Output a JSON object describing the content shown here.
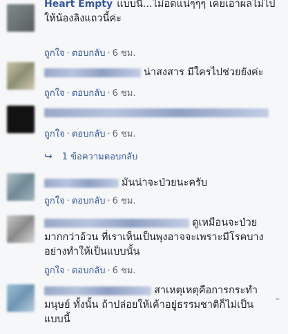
{
  "meta": {
    "like": "ถูกใจ",
    "sep": "·",
    "reply": "ตอบกลับ",
    "time": "6 ชม."
  },
  "comments": [
    {
      "name": "Heart Empty",
      "text": "แบบนี้...ไม่อดแน่ๆๆๆ เคยเอาผลไม่ไปให้น้องลิงแถวนี้ค่ะ"
    },
    {
      "text": "น่าสงสาร มีใครไปช่วยยังค่ะ"
    },
    {
      "text": ""
    },
    {
      "text": "มันน่าจะป่วยนะครับ"
    },
    {
      "text": "ดูเหมือนจะป่วย มากกว่าอ้วน ที่เราเห็นเป็นพุงอาจจะเพราะมีโรคบางอย่างทำให้เป็นแบบนั้น"
    },
    {
      "text": "สาเหตุเหตุคือการกระทำมนุษย์ ทั้งนั้น ถ้าปล่อยให้เค้าอยู่ธรรมชาติก็ไม่เป็นแบบนี้"
    }
  ],
  "replies_link": "1 ข้อความตอบกลับ",
  "colors": {
    "link": "#365899",
    "meta": "#616770",
    "bg": "#f6f7f9"
  }
}
